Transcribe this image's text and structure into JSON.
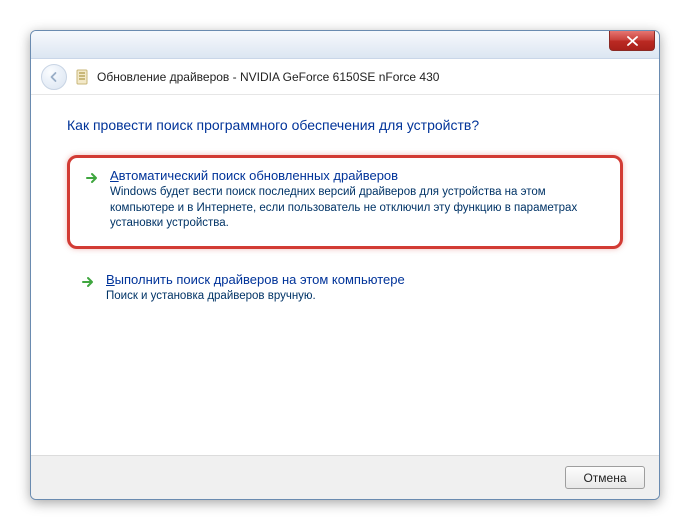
{
  "window": {
    "title": "Обновление драйверов - NVIDIA GeForce 6150SE nForce 430"
  },
  "heading": "Как провести поиск программного обеспечения для устройств?",
  "options": [
    {
      "mnemonic": "А",
      "title_rest": "втоматический поиск обновленных драйверов",
      "desc": "Windows будет вести поиск последних версий драйверов для устройства на этом компьютере и в Интернете, если пользователь не отключил эту функцию в параметрах установки устройства."
    },
    {
      "mnemonic": "В",
      "title_rest": "ыполнить поиск драйверов на этом компьютере",
      "desc": "Поиск и установка драйверов вручную."
    }
  ],
  "footer": {
    "cancel": "Отмена"
  }
}
